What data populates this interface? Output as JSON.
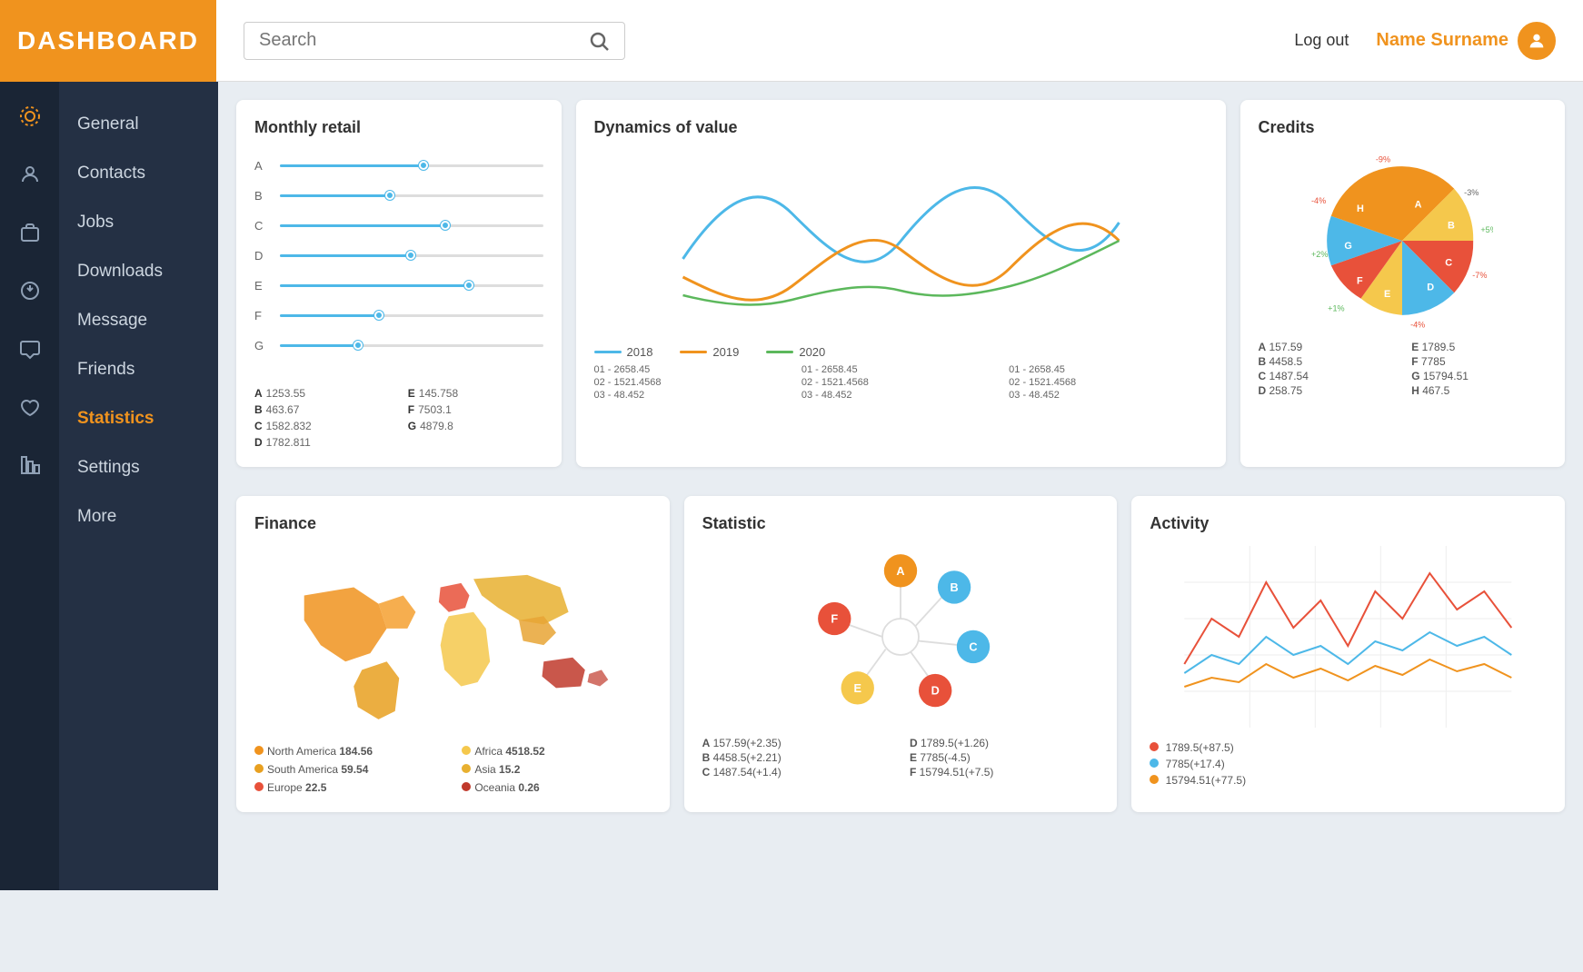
{
  "header": {
    "logo": "DASHBOARD",
    "search_placeholder": "Search",
    "logout_label": "Log out",
    "user_name": "Name Surname"
  },
  "icon_sidebar": {
    "icons": [
      {
        "name": "general-icon",
        "label": "general"
      },
      {
        "name": "contacts-icon",
        "label": "contacts"
      },
      {
        "name": "jobs-icon",
        "label": "jobs"
      },
      {
        "name": "downloads-icon",
        "label": "downloads"
      },
      {
        "name": "message-icon",
        "label": "message"
      },
      {
        "name": "friends-icon",
        "label": "friends"
      },
      {
        "name": "statistics-icon",
        "label": "statistics"
      }
    ]
  },
  "text_sidebar": {
    "items": [
      {
        "label": "General",
        "active": false
      },
      {
        "label": "Contacts",
        "active": false
      },
      {
        "label": "Jobs",
        "active": false
      },
      {
        "label": "Downloads",
        "active": false
      },
      {
        "label": "Message",
        "active": false
      },
      {
        "label": "Friends",
        "active": false
      },
      {
        "label": "Statistics",
        "active": true
      },
      {
        "label": "Settings",
        "active": false
      },
      {
        "label": "More",
        "active": false
      }
    ]
  },
  "cards": {
    "monthly_retail": {
      "title": "Monthly retail",
      "rows": [
        {
          "label": "A",
          "pct": 55
        },
        {
          "label": "B",
          "pct": 42
        },
        {
          "label": "C",
          "pct": 63
        },
        {
          "label": "D",
          "pct": 50
        },
        {
          "label": "E",
          "pct": 72
        },
        {
          "label": "F",
          "pct": 38
        },
        {
          "label": "G",
          "pct": 30
        }
      ],
      "stats": [
        {
          "key": "A",
          "val": "1253.55"
        },
        {
          "key": "E",
          "val": "145.758"
        },
        {
          "key": "B",
          "val": "463.67"
        },
        {
          "key": "F",
          "val": "7503.1"
        },
        {
          "key": "C",
          "val": "1582.832"
        },
        {
          "key": "G",
          "val": "4879.8"
        },
        {
          "key": "D",
          "val": "1782.811"
        }
      ]
    },
    "dynamics": {
      "title": "Dynamics of value",
      "legend": [
        {
          "label": "2018",
          "color": "#4db8e8"
        },
        {
          "label": "2019",
          "color": "#f0931e"
        },
        {
          "label": "2020",
          "color": "#5cb85c"
        }
      ],
      "data_rows": [
        "01 - 2658.45",
        "01 - 2658.45",
        "01 - 2658.45",
        "02 - 1521.4568",
        "02 - 1521.4568",
        "02 - 1521.4568",
        "03 - 48.452",
        "03 - 48.452",
        "03 - 48.452"
      ]
    },
    "credits": {
      "title": "Credits",
      "segments": [
        {
          "label": "A",
          "color": "#f0931e",
          "pct": "-9%"
        },
        {
          "label": "B",
          "color": "#f5c84c",
          "pct": "-3%"
        },
        {
          "label": "C",
          "color": "#e8513a",
          "pct": "+5%"
        },
        {
          "label": "D",
          "color": "#4db8e8",
          "pct": "-7%"
        },
        {
          "label": "E",
          "color": "#f5c84c",
          "pct": "-4%"
        },
        {
          "label": "F",
          "color": "#e8513a",
          "pct": "+1%"
        },
        {
          "label": "G",
          "color": "#4db8e8",
          "pct": "+2%"
        },
        {
          "label": "H",
          "color": "#f0931e",
          "pct": "-4%"
        }
      ],
      "data": [
        {
          "key": "A",
          "val": "157.59"
        },
        {
          "key": "E",
          "val": "1789.5"
        },
        {
          "key": "B",
          "val": "4458.5"
        },
        {
          "key": "F",
          "val": "7785"
        },
        {
          "key": "C",
          "val": "1487.54"
        },
        {
          "key": "G",
          "val": "15794.51"
        },
        {
          "key": "D",
          "val": "258.75"
        },
        {
          "key": "H",
          "val": "467.5"
        }
      ]
    },
    "finance": {
      "title": "Finance",
      "legend": [
        {
          "label": "North America",
          "val": "184.56",
          "color": "#f0931e"
        },
        {
          "label": "Africa",
          "val": "4518.52",
          "color": "#f5c84c"
        },
        {
          "label": "South America",
          "val": "59.54",
          "color": "#e8a020"
        },
        {
          "label": "Asia",
          "val": "15.2",
          "color": "#e8c050"
        },
        {
          "label": "Europe",
          "val": "22.5",
          "color": "#e8513a"
        },
        {
          "label": "Oceania",
          "val": "0.26",
          "color": "#c0392b"
        }
      ]
    },
    "statistic": {
      "title": "Statistic",
      "nodes": [
        {
          "label": "A",
          "color": "#f0931e"
        },
        {
          "label": "B",
          "color": "#4db8e8"
        },
        {
          "label": "C",
          "color": "#4db8e8"
        },
        {
          "label": "D",
          "color": "#e8513a"
        },
        {
          "label": "E",
          "color": "#f5c84c"
        },
        {
          "label": "F",
          "color": "#e8513a"
        }
      ],
      "data": [
        {
          "key": "A",
          "val": "157.59(+2.35)"
        },
        {
          "key": "D",
          "val": "1789.5(+1.26)"
        },
        {
          "key": "B",
          "val": "4458.5(+2.21)"
        },
        {
          "key": "E",
          "val": "7785(-4.5)"
        },
        {
          "key": "C",
          "val": "1487.54(+1.4)"
        },
        {
          "key": "F",
          "val": "15794.51(+7.5)"
        }
      ]
    },
    "activity": {
      "title": "Activity",
      "legend": [
        {
          "val": "1789.5(+87.5)",
          "color": "#e8513a"
        },
        {
          "val": "7785(+17.4)",
          "color": "#4db8e8"
        },
        {
          "val": "15794.51(+77.5)",
          "color": "#f0931e"
        }
      ]
    }
  }
}
